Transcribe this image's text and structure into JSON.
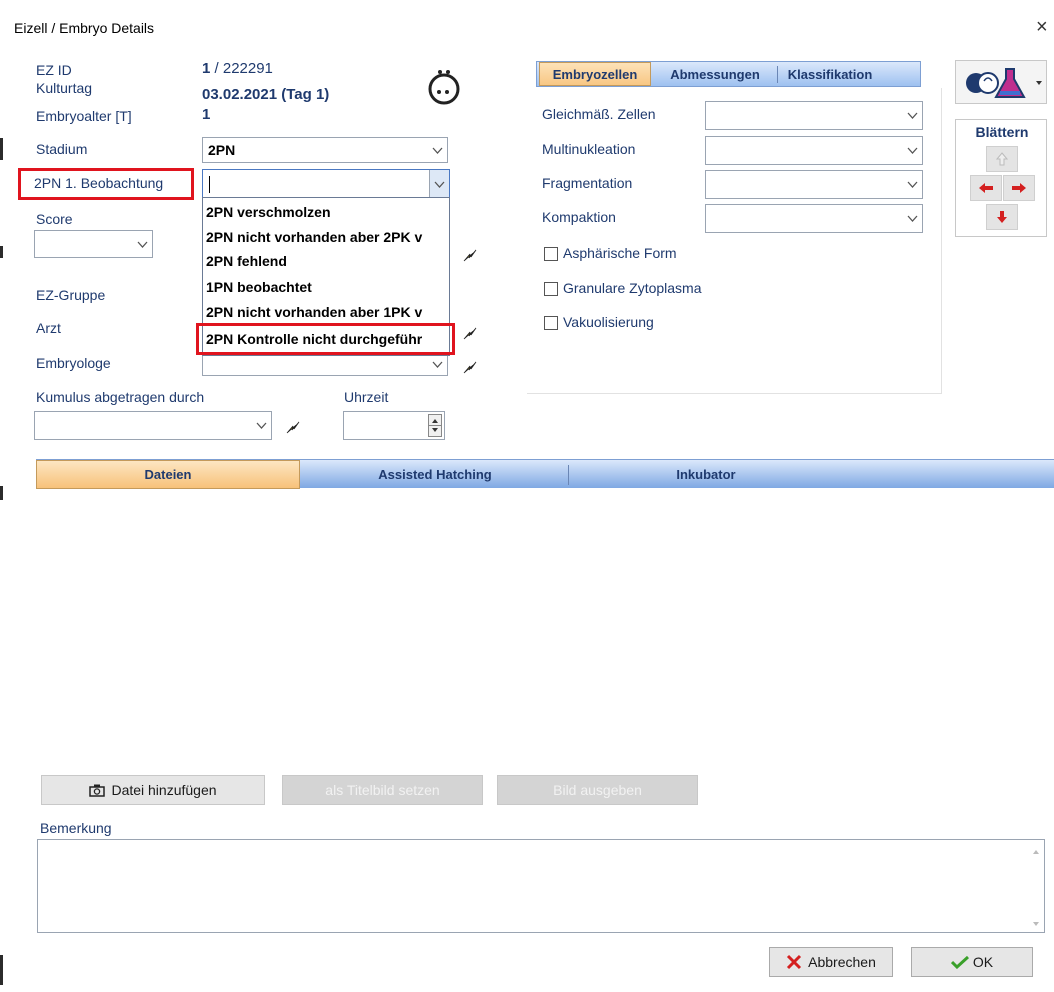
{
  "window": {
    "title": "Eizell / Embryo Details",
    "close_glyph": "×"
  },
  "header": {
    "ez_id_label": "EZ ID",
    "ez_id_value_num": "1",
    "ez_id_value_rest": " / 222291",
    "kulturtag_label": "Kulturtag",
    "kulturtag_value": "03.02.2021  (Tag 1)",
    "embryoalter_label": "Embryoalter [T]",
    "embryoalter_value": "1"
  },
  "fields": {
    "stadium_label": "Stadium",
    "stadium_value": "2PN",
    "beobachtung_label": "2PN 1. Beobachtung",
    "beobachtung_value": "",
    "score_label": "Score",
    "score_value": "",
    "ez_gruppe_label": "EZ-Gruppe",
    "arzt_label": "Arzt",
    "embryologe_label": "Embryologe",
    "kumulus_label": "Kumulus abgetragen durch",
    "kumulus_value": "",
    "uhrzeit_label": "Uhrzeit",
    "uhrzeit_value": ""
  },
  "dropdown": {
    "options": [
      "2PN verschmolzen",
      "2PN nicht vorhanden aber 2PK v",
      "2PN fehlend",
      "1PN beobachtet",
      "2PN nicht vorhanden aber 1PK v",
      "2PN Kontrolle nicht durchgeführ"
    ]
  },
  "top_tabs": [
    "Embryozellen",
    "Abmessungen",
    "Klassifikation"
  ],
  "embryozellen": {
    "gleichmass_label": "Gleichmäß. Zellen",
    "multinukleation_label": "Multinukleation",
    "fragmentation_label": "Fragmentation",
    "kompaktion_label": "Kompaktion",
    "checkboxes": [
      "Asphärische Form",
      "Granulare Zytoplasma",
      "Vakuolisierung"
    ]
  },
  "navigation": {
    "title": "Blättern"
  },
  "bottom_tabs": [
    "Dateien",
    "Assisted Hatching",
    "Inkubator"
  ],
  "files": {
    "add_file": "Datei hinzufügen",
    "set_title_image": "als Titelbild setzen",
    "export_image": "Bild ausgeben"
  },
  "bemerkung": {
    "label": "Bemerkung",
    "value": ""
  },
  "footer": {
    "cancel": "Abbrechen",
    "ok": "OK"
  },
  "colors": {
    "label_blue": "#1f3a6e",
    "highlight_red": "#e0141e",
    "tab_orange": "#f8c784",
    "tab_blue": "#9ec1f0"
  }
}
